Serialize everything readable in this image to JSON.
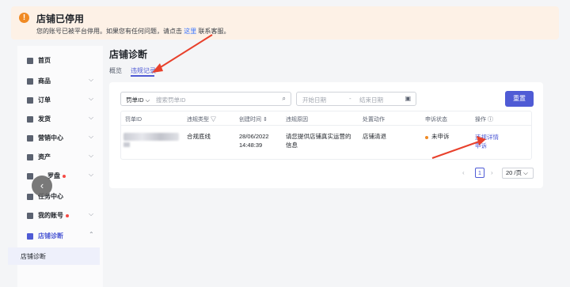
{
  "banner": {
    "title": "店铺已停用",
    "desc_prefix": "您的账号已被平台停用。如果您有任何问题，请点击",
    "desc_link": "这里",
    "desc_suffix": "联系客服。"
  },
  "sidebar": {
    "items": [
      {
        "label": "首页",
        "icon": "home-icon"
      },
      {
        "label": "商品",
        "icon": "product-icon"
      },
      {
        "label": "订单",
        "icon": "order-icon"
      },
      {
        "label": "发货",
        "icon": "shipping-icon"
      },
      {
        "label": "营销中心",
        "icon": "marketing-icon"
      },
      {
        "label": "资产",
        "icon": "wallet-icon"
      },
      {
        "label": "罗盘",
        "icon": "compass-icon"
      },
      {
        "label": "任务中心",
        "icon": "task-icon"
      },
      {
        "label": "我的账号",
        "icon": "user-icon"
      },
      {
        "label": "店铺诊断",
        "icon": "diagnose-icon"
      }
    ],
    "sub_item": "店铺诊断"
  },
  "main": {
    "title": "店铺诊断",
    "tabs": [
      {
        "label": "概览"
      },
      {
        "label": "违规记录"
      }
    ],
    "filter": {
      "select_label": "罚单ID",
      "search_placeholder": "搜索罚单ID",
      "start_date": "开始日期",
      "end_date": "结束日期",
      "reset_label": "重置"
    },
    "table": {
      "headers": [
        "罚单ID",
        "违规类型",
        "创建时间",
        "违规原因",
        "处置动作",
        "申诉状态",
        "操作"
      ],
      "row": {
        "type": "合规底线",
        "date": "28/06/2022",
        "time": "14:48:39",
        "reason_line1": "请您提供店铺真实运营的",
        "reason_line2": "信息",
        "action": "店铺清退",
        "status": "未申诉",
        "op1": "违规详情",
        "op2": "申诉"
      }
    },
    "pager": {
      "page": "1",
      "size": "20 /页"
    }
  },
  "colors": {
    "accent": "#4f5bd5",
    "banner_bg": "#fdf1e6",
    "warning": "#f08a24",
    "annotation_arrow": "#e8412c"
  }
}
